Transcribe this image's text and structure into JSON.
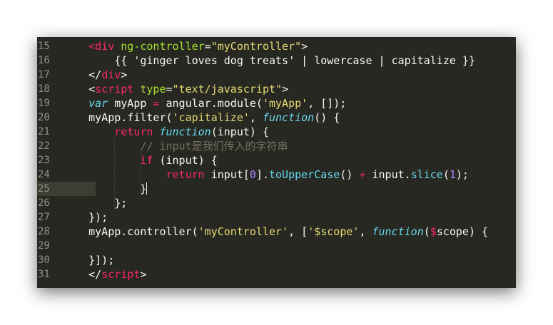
{
  "editor": {
    "lines": [
      {
        "no": "15",
        "indent": "    ",
        "tokens": [
          {
            "t": "<",
            "c": "tag"
          },
          {
            "t": "div",
            "c": "tag"
          },
          {
            "t": " ",
            "c": ""
          },
          {
            "t": "ng-controller",
            "c": "attr"
          },
          {
            "t": "=",
            "c": ""
          },
          {
            "t": "\"myController\"",
            "c": "str"
          },
          {
            "t": ">",
            "c": ""
          }
        ]
      },
      {
        "no": "16",
        "indent": "        ",
        "tokens": [
          {
            "t": "{{ 'ginger loves dog treats' | lowercase | capitalize }}",
            "c": ""
          }
        ]
      },
      {
        "no": "17",
        "indent": "    ",
        "tokens": [
          {
            "t": "</",
            "c": ""
          },
          {
            "t": "div",
            "c": "tag"
          },
          {
            "t": ">",
            "c": ""
          }
        ]
      },
      {
        "no": "18",
        "indent": "    ",
        "tokens": [
          {
            "t": "<",
            "c": ""
          },
          {
            "t": "script",
            "c": "tag"
          },
          {
            "t": " ",
            "c": ""
          },
          {
            "t": "type",
            "c": "attr"
          },
          {
            "t": "=",
            "c": ""
          },
          {
            "t": "\"text/javascript\"",
            "c": "str"
          },
          {
            "t": ">",
            "c": ""
          }
        ]
      },
      {
        "no": "19",
        "indent": "    ",
        "tokens": [
          {
            "t": "var",
            "c": "fni"
          },
          {
            "t": " myApp ",
            "c": ""
          },
          {
            "t": "=",
            "c": "op"
          },
          {
            "t": " angular.module(",
            "c": ""
          },
          {
            "t": "'myApp'",
            "c": "str"
          },
          {
            "t": ", []);",
            "c": ""
          }
        ]
      },
      {
        "no": "20",
        "indent": "    ",
        "tokens": [
          {
            "t": "myApp.filter(",
            "c": ""
          },
          {
            "t": "'capitalize'",
            "c": "str"
          },
          {
            "t": ", ",
            "c": ""
          },
          {
            "t": "function",
            "c": "fni"
          },
          {
            "t": "() {",
            "c": ""
          }
        ]
      },
      {
        "no": "21",
        "indent": "        ",
        "tokens": [
          {
            "t": "return",
            "c": "kw"
          },
          {
            "t": " ",
            "c": ""
          },
          {
            "t": "function",
            "c": "fni"
          },
          {
            "t": "(input) {",
            "c": ""
          }
        ]
      },
      {
        "no": "22",
        "indent": "            ",
        "tokens": [
          {
            "t": "// input是我们传入的字符串",
            "c": "cm"
          }
        ]
      },
      {
        "no": "23",
        "indent": "            ",
        "tokens": [
          {
            "t": "if",
            "c": "kw"
          },
          {
            "t": " (input) {",
            "c": ""
          }
        ]
      },
      {
        "no": "24",
        "indent": "                ",
        "tokens": [
          {
            "t": "return",
            "c": "kw"
          },
          {
            "t": " input[",
            "c": ""
          },
          {
            "t": "0",
            "c": "num"
          },
          {
            "t": "].",
            "c": ""
          },
          {
            "t": "toUpperCase",
            "c": "fn"
          },
          {
            "t": "() ",
            "c": ""
          },
          {
            "t": "+",
            "c": "op"
          },
          {
            "t": " input.",
            "c": ""
          },
          {
            "t": "slice",
            "c": "fn"
          },
          {
            "t": "(",
            "c": ""
          },
          {
            "t": "1",
            "c": "num"
          },
          {
            "t": ");",
            "c": ""
          }
        ]
      },
      {
        "no": "25",
        "indent": "            ",
        "tokens": [
          {
            "t": "}",
            "c": ""
          }
        ],
        "current": true
      },
      {
        "no": "26",
        "indent": "        ",
        "tokens": [
          {
            "t": "};",
            "c": ""
          }
        ]
      },
      {
        "no": "27",
        "indent": "    ",
        "tokens": [
          {
            "t": "});",
            "c": ""
          }
        ]
      },
      {
        "no": "28",
        "indent": "    ",
        "tokens": [
          {
            "t": "myApp.controller(",
            "c": ""
          },
          {
            "t": "'myController'",
            "c": "str"
          },
          {
            "t": ", [",
            "c": ""
          },
          {
            "t": "'$scope'",
            "c": "str"
          },
          {
            "t": ", ",
            "c": ""
          },
          {
            "t": "function",
            "c": "fni"
          },
          {
            "t": "(",
            "c": ""
          },
          {
            "t": "$",
            "c": "op"
          },
          {
            "t": "scope) {",
            "c": ""
          }
        ]
      },
      {
        "no": "29",
        "indent": "",
        "tokens": []
      },
      {
        "no": "30",
        "indent": "    ",
        "tokens": [
          {
            "t": "}]);",
            "c": ""
          }
        ]
      },
      {
        "no": "31",
        "indent": "    ",
        "tokens": [
          {
            "t": "</",
            "c": ""
          },
          {
            "t": "script",
            "c": "tag"
          },
          {
            "t": ">",
            "c": ""
          }
        ]
      }
    ]
  },
  "colors": {
    "background": "#272822",
    "tag": "#f92672",
    "attribute": "#a6e22e",
    "string": "#e6db74",
    "function": "#66d9ef",
    "number": "#ae81ff",
    "comment": "#75715e"
  }
}
